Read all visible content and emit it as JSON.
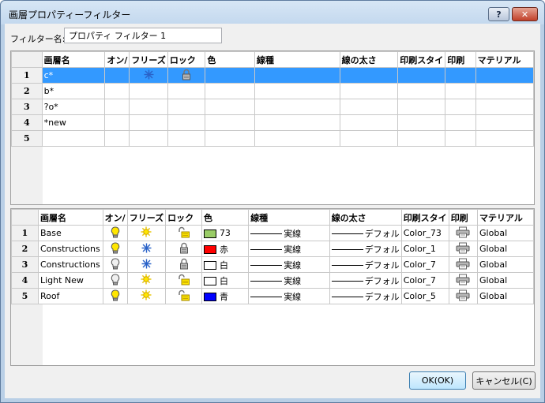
{
  "window": {
    "title": "画層プロパティーフィルター",
    "help_label": "?",
    "close_label": "✕"
  },
  "filter": {
    "label": "フィルター名:",
    "value": "プロパティ フィルター 1"
  },
  "columns": [
    "画層名",
    "オン/",
    "フリーズ",
    "ロック",
    "色",
    "線種",
    "線の太さ",
    "印刷スタイ",
    "印刷",
    "マテリアル"
  ],
  "filter_rows": [
    {
      "num": "1",
      "name": "c*",
      "freeze": "snowflake-icon",
      "lock": "lock-icon",
      "selected": true
    },
    {
      "num": "2",
      "name": "b*"
    },
    {
      "num": "3",
      "name": "?o*"
    },
    {
      "num": "4",
      "name": "*new"
    },
    {
      "num": "5",
      "name": ""
    }
  ],
  "layer_rows": [
    {
      "num": "1",
      "name": "Base",
      "on": "bulb-on",
      "freeze": "sun",
      "lock": "unlocked",
      "color": "73",
      "swatch": "#99cc66",
      "linetype": "実線",
      "lineweight": "デフォル",
      "plotstyle": "Color_73",
      "material": "Global"
    },
    {
      "num": "2",
      "name": "Constructions",
      "on": "bulb-on",
      "freeze": "snowflake",
      "lock": "locked",
      "color": "赤",
      "swatch": "#ff0000",
      "linetype": "実線",
      "lineweight": "デフォル",
      "plotstyle": "Color_1",
      "material": "Global"
    },
    {
      "num": "3",
      "name": "Constructions",
      "on": "bulb-off",
      "freeze": "snowflake",
      "lock": "locked",
      "color": "白",
      "swatch": "#ffffff",
      "linetype": "実線",
      "lineweight": "デフォル",
      "plotstyle": "Color_7",
      "material": "Global"
    },
    {
      "num": "4",
      "name": "Light New",
      "on": "bulb-off",
      "freeze": "sun",
      "lock": "unlocked",
      "color": "白",
      "swatch": "#ffffff",
      "linetype": "実線",
      "lineweight": "デフォル",
      "plotstyle": "Color_7",
      "material": "Global"
    },
    {
      "num": "5",
      "name": "Roof",
      "on": "bulb-on",
      "freeze": "sun",
      "lock": "unlocked",
      "color": "青",
      "swatch": "#0000ff",
      "linetype": "実線",
      "lineweight": "デフォル",
      "plotstyle": "Color_5",
      "material": "Global"
    }
  ],
  "buttons": {
    "ok": "OK(OK)",
    "cancel": "キャンセル(C)"
  }
}
